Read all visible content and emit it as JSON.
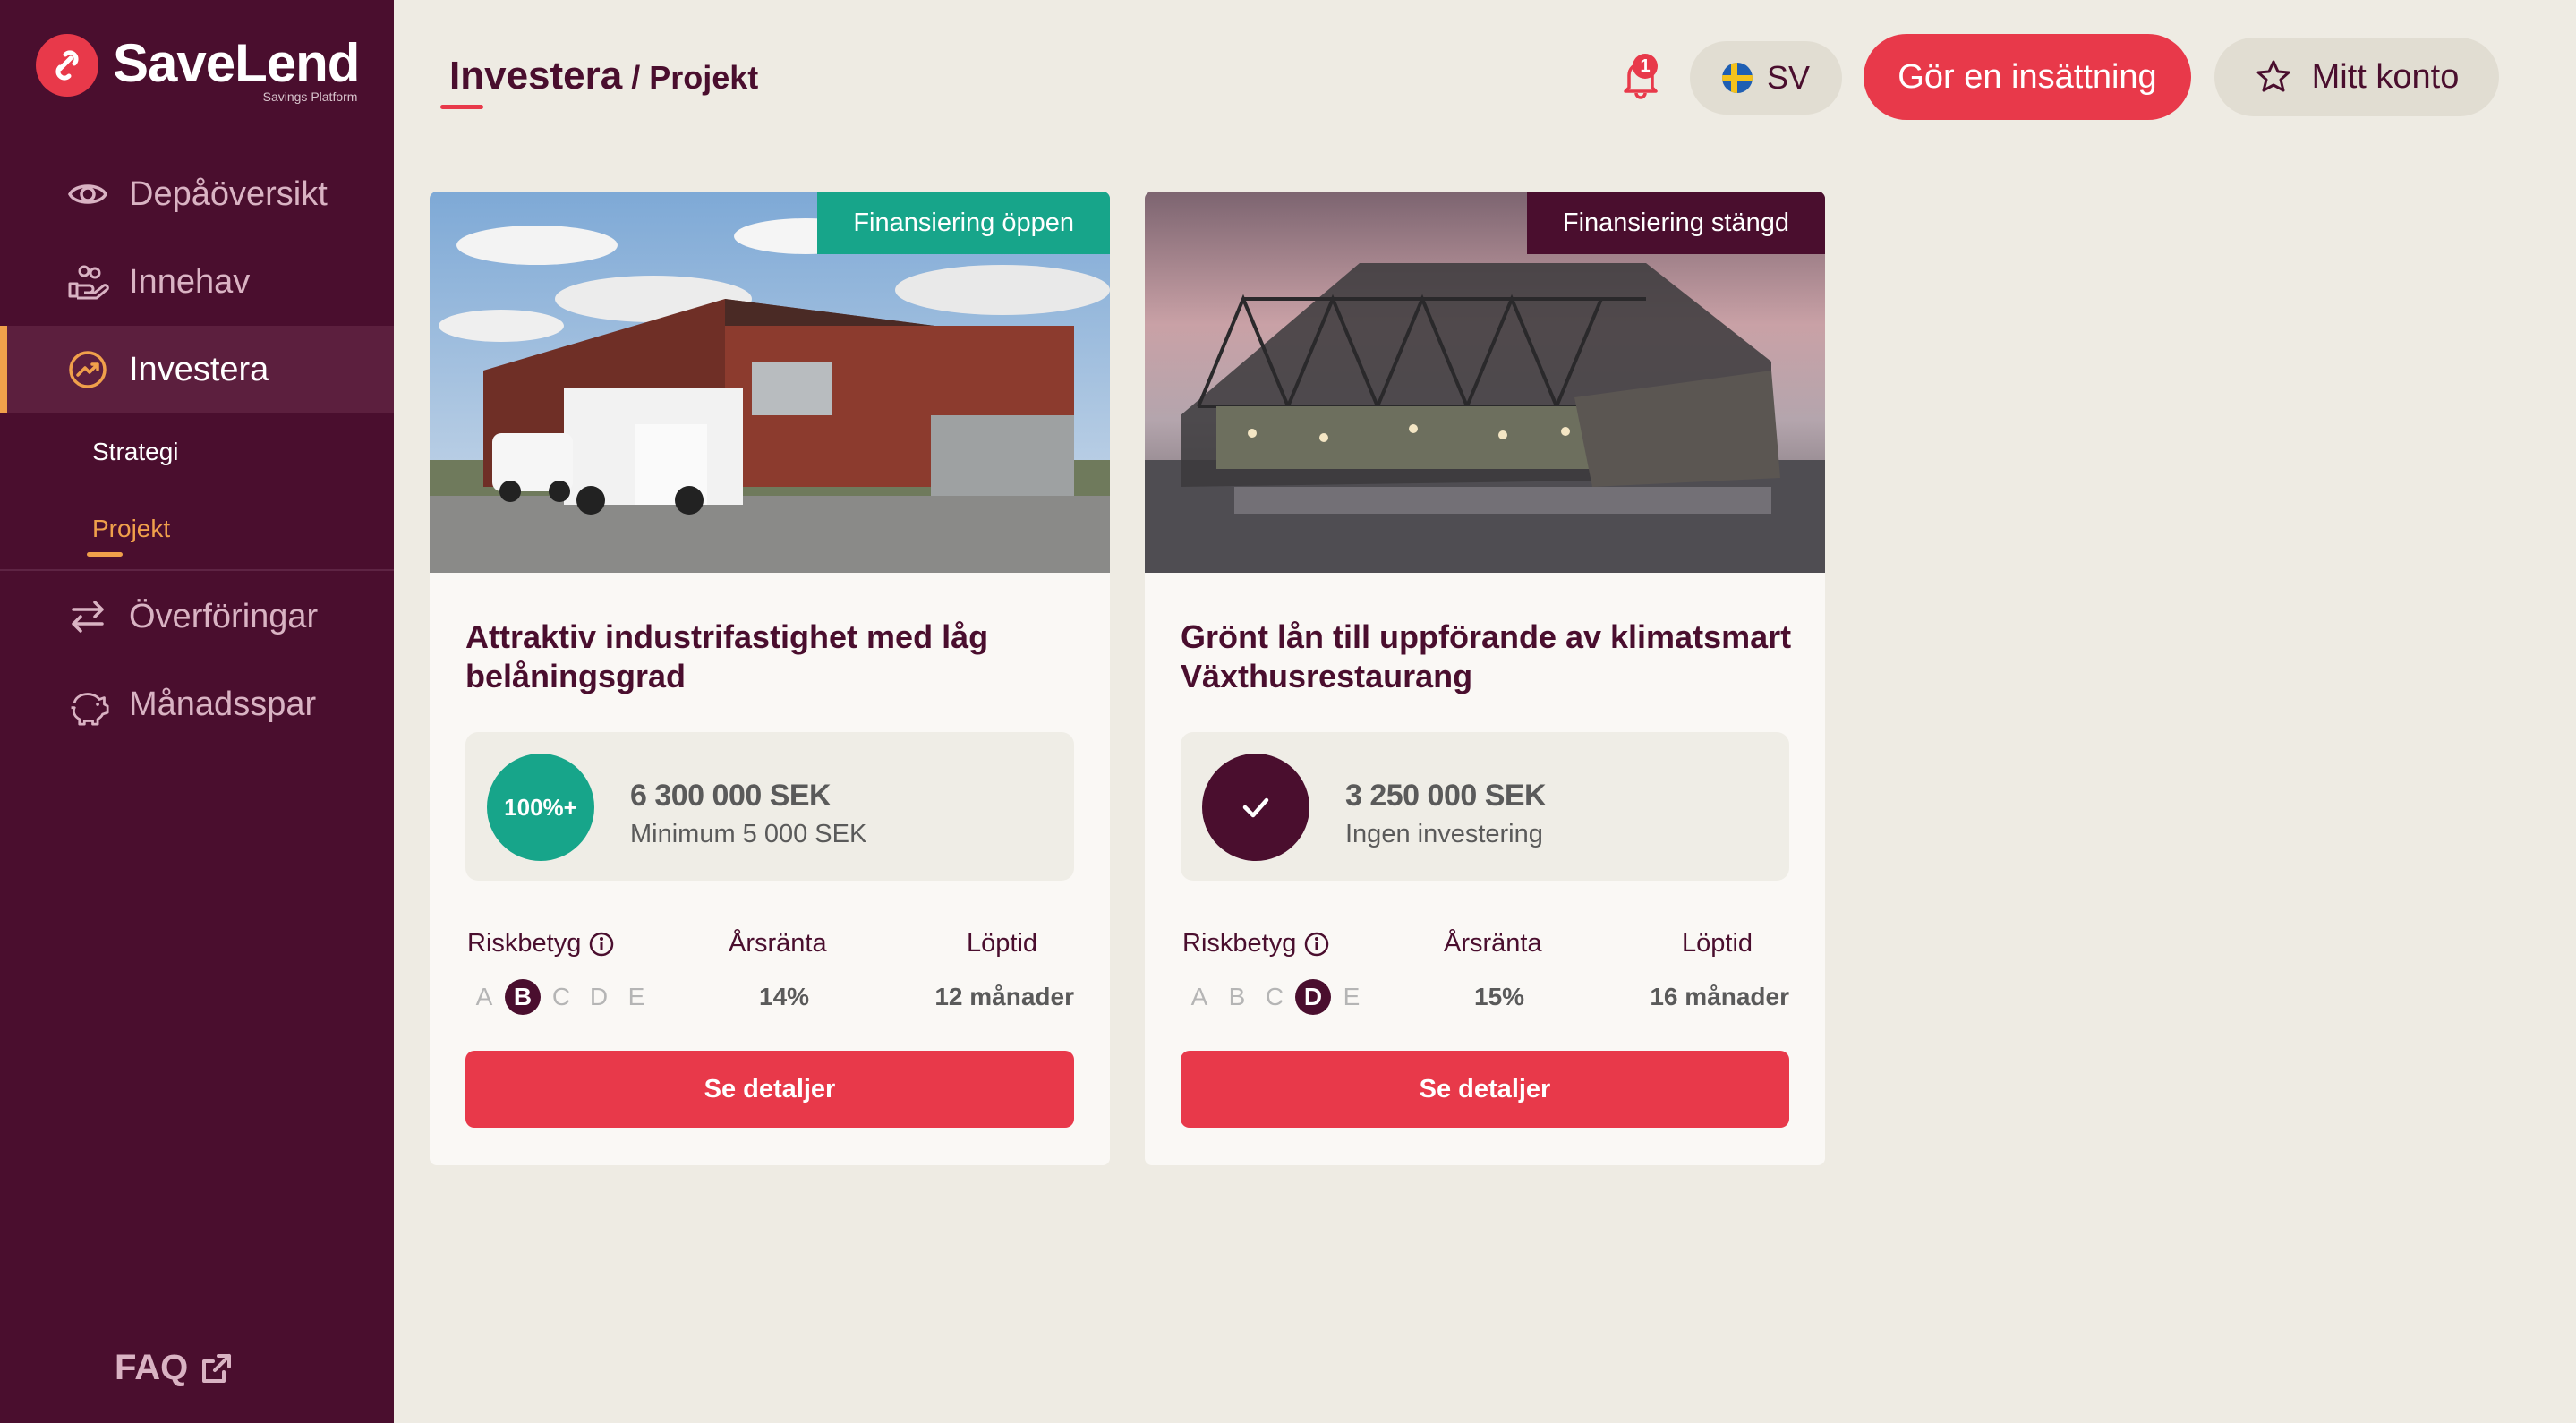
{
  "brand": {
    "name": "SaveLend",
    "tagline": "Savings Platform"
  },
  "sidebar": {
    "items": [
      {
        "label": "Depåöversikt",
        "icon": "eye-icon"
      },
      {
        "label": "Innehav",
        "icon": "hand-coins-icon"
      },
      {
        "label": "Investera",
        "icon": "trending-up-icon",
        "active": true
      },
      {
        "label": "Överföringar",
        "icon": "transfer-arrows-icon"
      },
      {
        "label": "Månadsspar",
        "icon": "piggy-bank-icon"
      }
    ],
    "subitems": [
      {
        "label": "Strategi"
      },
      {
        "label": "Projekt",
        "active": true
      }
    ],
    "faq": "FAQ"
  },
  "header": {
    "breadcrumb_main": "Investera",
    "breadcrumb_sep": "/",
    "breadcrumb_sub": "Projekt",
    "notification_count": "1",
    "language": "SV",
    "deposit_label": "Gör en insättning",
    "account_label": "Mitt konto"
  },
  "stat_labels": {
    "risk": "Riskbetyg",
    "rate": "Årsränta",
    "term": "Löptid"
  },
  "risk_letters": [
    "A",
    "B",
    "C",
    "D",
    "E"
  ],
  "projects": [
    {
      "status": "Finansiering öppen",
      "title": "Attraktiv industrifastighet med låg belåningsgrad",
      "amount": "6 300 000 SEK",
      "amount_sub": "Minimum 5 000 SEK",
      "circle_text": "100%+",
      "risk": "B",
      "rate": "14%",
      "term": "12 månader",
      "button": "Se detaljer"
    },
    {
      "status": "Finansiering stängd",
      "title": "Grönt lån till uppförande av klimatsmart Växthusrestaurang",
      "amount": "3 250 000 SEK",
      "amount_sub": "Ingen investering",
      "circle_text": "",
      "risk": "D",
      "rate": "15%",
      "term": "16 månader",
      "button": "Se detaljer"
    }
  ],
  "colors": {
    "sidebar_bg": "#4a0e2e",
    "accent_red": "#e8394a",
    "accent_orange": "#f0a04b",
    "open_green": "#17a58a",
    "closed_plum": "#4a0e2e",
    "page_bg": "#eeebe3"
  }
}
